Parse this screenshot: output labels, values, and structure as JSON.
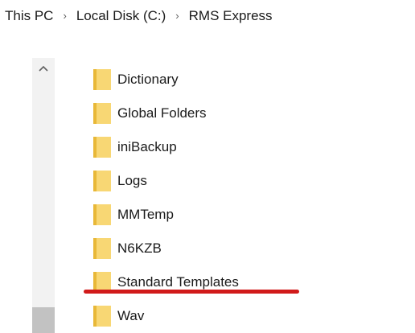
{
  "breadcrumb": {
    "items": [
      "This PC",
      "Local Disk (C:)",
      "RMS Express"
    ],
    "separator": "›"
  },
  "scrollbar": {
    "up_arrow": "^"
  },
  "folders": [
    {
      "name": "Dictionary"
    },
    {
      "name": "Global Folders"
    },
    {
      "name": "iniBackup"
    },
    {
      "name": "Logs"
    },
    {
      "name": "MMTemp"
    },
    {
      "name": "N6KZB"
    },
    {
      "name": "Standard Templates"
    },
    {
      "name": "Wav"
    }
  ],
  "annotation": {
    "highlighted_item": "Standard Templates",
    "underline_color": "#d11a1a"
  },
  "colors": {
    "folder_fill": "#f8d774",
    "folder_shade": "#e8b838",
    "scrollbar_track": "#f2f2f2",
    "scrollbar_thumb": "#c2c2c2"
  },
  "icons": {
    "folder": "folder-icon",
    "chevron_up": "chevron-up-icon",
    "breadcrumb_separator": "chevron-right-icon"
  }
}
